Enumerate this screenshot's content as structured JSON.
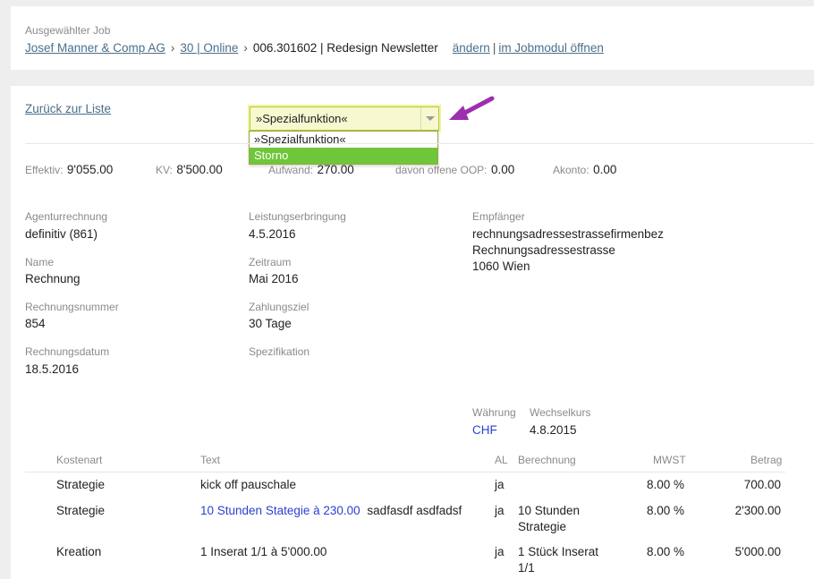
{
  "selected_job": {
    "label": "Ausgewählter Job",
    "customer_link": "Josef Manner & Comp AG",
    "sep1": "›",
    "campaign_link": "30 | Online",
    "sep2": "›",
    "job_text": "006.301602 | Redesign Newsletter",
    "change_link": "ändern",
    "pipe": "|",
    "open_module_link": "im Jobmodul öffnen"
  },
  "back_link": "Zurück zur Liste",
  "special_select": {
    "value": "»Spezialfunktion«",
    "options": [
      "»Spezialfunktion«",
      "Storno"
    ],
    "highlighted_index": 1
  },
  "colors": {
    "annotation_arrow": "#9b2fae",
    "option_highlight": "#6fc63a",
    "link_blue": "#2a3fd0",
    "link": "#4a6f8a"
  },
  "summary": {
    "effektiv_label": "Effektiv:",
    "effektiv_value": "9'055.00",
    "kv_label": "KV:",
    "kv_value": "8'500.00",
    "aufwand_label": "Aufwand:",
    "aufwand_value": "270.00",
    "oop_label": "davon offene OOP:",
    "oop_value": "0.00",
    "akonto_label": "Akonto:",
    "akonto_value": "0.00"
  },
  "details": {
    "agenturrechnung_label": "Agenturrechnung",
    "agenturrechnung_value": "definitiv (861)",
    "name_label": "Name",
    "name_value": "Rechnung",
    "rechnungsnummer_label": "Rechnungsnummer",
    "rechnungsnummer_value": "854",
    "rechnungsdatum_label": "Rechnungsdatum",
    "rechnungsdatum_value": "18.5.2016",
    "leistung_label": "Leistungserbringung",
    "leistung_value": "4.5.2016",
    "zeitraum_label": "Zeitraum",
    "zeitraum_value": "Mai 2016",
    "zahlungsziel_label": "Zahlungsziel",
    "zahlungsziel_value": "30 Tage",
    "spezifikation_label": "Spezifikation",
    "empfaenger_label": "Empfänger",
    "empfaenger_line1": "rechnungsadressestrassefirmenbez",
    "empfaenger_line2": "Rechnungsadressestrasse",
    "empfaenger_line3": "1060 Wien",
    "waehrung_label": "Währung",
    "waehrung_value": "CHF",
    "wechselkurs_label": "Wechselkurs",
    "wechselkurs_value": "4.8.2015"
  },
  "table": {
    "headers": [
      "Kostenart",
      "Text",
      "AL",
      "Berechnung",
      "MWST",
      "Betrag"
    ],
    "rows": [
      {
        "kostenart": "Strategie",
        "text_plain": "kick off pauschale",
        "text_link": "",
        "al": "ja",
        "berechnung_1": "",
        "berechnung_2": "",
        "mwst": "8.00 %",
        "betrag": "700.00"
      },
      {
        "kostenart": "Strategie",
        "text_plain": "sadfasdf asdfadsf",
        "text_link": "10 Stunden Stategie à 230.00",
        "al": "ja",
        "berechnung_1": "10 Stunden",
        "berechnung_2": "Strategie",
        "mwst": "8.00 %",
        "betrag": "2'300.00"
      },
      {
        "kostenart": "Kreation",
        "text_plain": "",
        "text_link": "1  Inserat 1/1 à 5'000.00",
        "al": "ja",
        "berechnung_1": "1 Stück Inserat",
        "berechnung_2": "1/1",
        "mwst": "8.00 %",
        "betrag": "5'000.00"
      }
    ]
  }
}
